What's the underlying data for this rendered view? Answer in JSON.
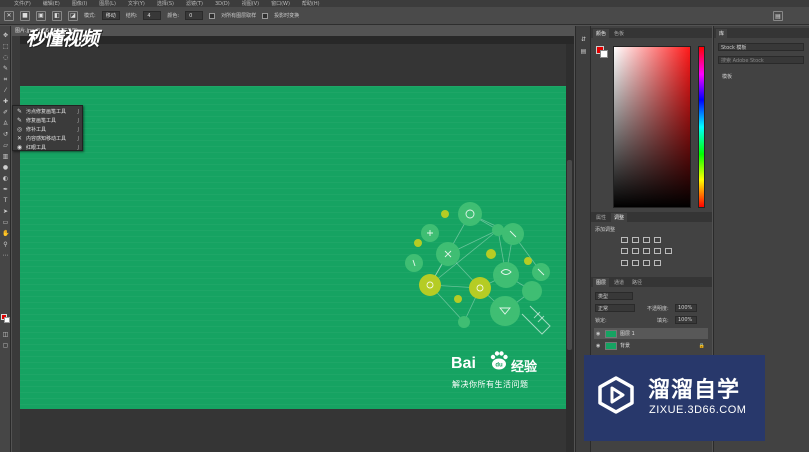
{
  "menubar": {
    "items": [
      "文件(F)",
      "编辑(E)",
      "图像(I)",
      "图层(L)",
      "文字(Y)",
      "选择(S)",
      "滤镜(T)",
      "3D(D)",
      "视图(V)",
      "窗口(W)",
      "帮助(H)"
    ]
  },
  "optionsbar": {
    "mode_label": "模式:",
    "mode_value": "移动",
    "structure_label": "结构:",
    "structure_value": "4",
    "color_label": "颜色:",
    "color_value": "0",
    "sample_all_label": "对所有图层取样",
    "transform_label": "投影时变换"
  },
  "document": {
    "tab_title": "图片.jpg @ 66.7%(RGB/8)",
    "watermark_text": "秒懂视频"
  },
  "flyout": {
    "items": [
      {
        "label": "污点修复画笔工具",
        "shortcut": "J",
        "icon": "spot-healing-icon"
      },
      {
        "label": "修复画笔工具",
        "shortcut": "J",
        "icon": "healing-brush-icon"
      },
      {
        "label": "修补工具",
        "shortcut": "J",
        "icon": "patch-icon"
      },
      {
        "label": "内容感知移动工具",
        "shortcut": "J",
        "icon": "content-aware-move-icon"
      },
      {
        "label": "红眼工具",
        "shortcut": "J",
        "icon": "red-eye-icon"
      }
    ]
  },
  "canvas": {
    "brand_bai": "Bai",
    "brand_du": "du",
    "brand_jingyan": "经验",
    "slogan": "解决你所有生活问题",
    "bg_color": "#16a362"
  },
  "panels": {
    "color_tabs": [
      "颜色",
      "色板"
    ],
    "adjust_tabs": [
      "属性",
      "调整"
    ],
    "adjust_title": "添加调整",
    "layer_tabs": [
      "图层",
      "通道",
      "路径"
    ],
    "layer_filter": "类型",
    "blend_mode": "正常",
    "opacity_label": "不透明度:",
    "opacity_value": "100%",
    "lock_label": "锁定:",
    "fill_label": "填充:",
    "fill_value": "100%",
    "layers": [
      {
        "name": "图层 1",
        "locked": false
      },
      {
        "name": "背景",
        "locked": true
      }
    ],
    "library_tab": "库",
    "library_select": "Stock 模板",
    "library_search": "搜索 Adobe Stock",
    "library_item": "模板"
  },
  "overlay": {
    "title": "溜溜自学",
    "url": "ZIXUE.3D66.COM",
    "bg_color": "#28386b"
  }
}
